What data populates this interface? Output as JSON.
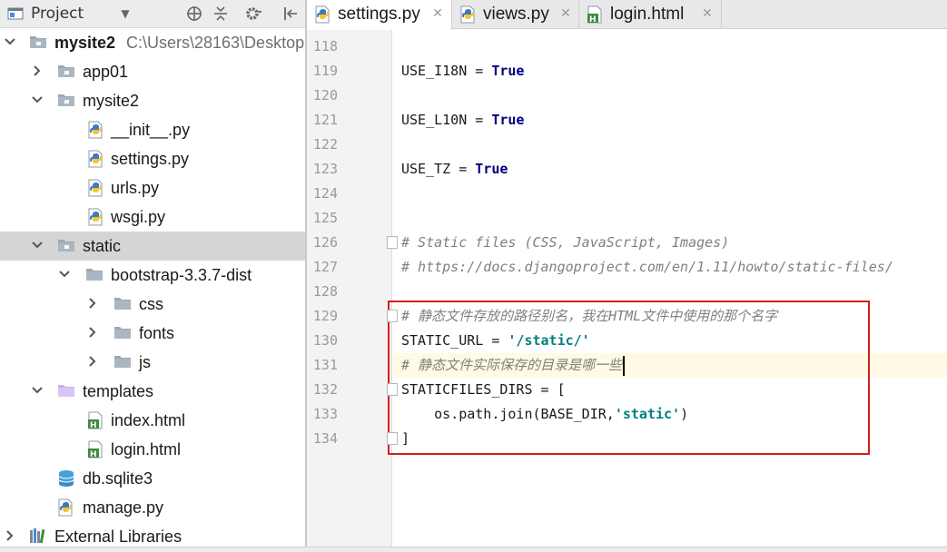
{
  "project_panel": {
    "title": "Project",
    "tree": [
      {
        "label": "mysite2",
        "path": "C:\\Users\\28163\\Desktop",
        "bold": true
      },
      {
        "label": "app01"
      },
      {
        "label": "mysite2"
      },
      {
        "label": "__init__.py"
      },
      {
        "label": "settings.py"
      },
      {
        "label": "urls.py"
      },
      {
        "label": "wsgi.py"
      },
      {
        "label": "static",
        "selected": true
      },
      {
        "label": "bootstrap-3.3.7-dist"
      },
      {
        "label": "css"
      },
      {
        "label": "fonts"
      },
      {
        "label": "js"
      },
      {
        "label": "templates"
      },
      {
        "label": "index.html"
      },
      {
        "label": "login.html"
      },
      {
        "label": "db.sqlite3"
      },
      {
        "label": "manage.py"
      },
      {
        "label": "External Libraries"
      }
    ]
  },
  "tabs": [
    {
      "label": "settings.py",
      "active": true,
      "icon": "python-file-icon"
    },
    {
      "label": "views.py",
      "active": false,
      "icon": "python-file-icon"
    },
    {
      "label": "login.html",
      "active": false,
      "icon": "html-file-icon"
    }
  ],
  "editor": {
    "line_numbers": [
      "118",
      "119",
      "120",
      "121",
      "122",
      "123",
      "124",
      "125",
      "126",
      "127",
      "128",
      "129",
      "130",
      "131",
      "132",
      "133",
      "134"
    ],
    "lines": [
      {
        "text": ""
      },
      {
        "parts": [
          {
            "t": "USE_I18N = "
          },
          {
            "t": "True",
            "c": "kw"
          }
        ]
      },
      {
        "text": ""
      },
      {
        "parts": [
          {
            "t": "USE_L10N = "
          },
          {
            "t": "True",
            "c": "kw"
          }
        ]
      },
      {
        "text": ""
      },
      {
        "parts": [
          {
            "t": "USE_TZ = "
          },
          {
            "t": "True",
            "c": "kw"
          }
        ]
      },
      {
        "text": ""
      },
      {
        "text": ""
      },
      {
        "text": "# Static files (CSS, JavaScript, Images)",
        "comment": true
      },
      {
        "text": "# https://docs.djangoproject.com/en/1.11/howto/static-files/",
        "comment": true
      },
      {
        "text": ""
      },
      {
        "text": "# 静态文件存放的路径别名，我在HTML文件中使用的那个名字",
        "comment": true
      },
      {
        "parts": [
          {
            "t": "STATIC_URL = "
          },
          {
            "t": "'/static/'",
            "c": "str"
          }
        ]
      },
      {
        "text": "# 静态文件实际保存的目录是哪一些",
        "comment": true,
        "caret": true
      },
      {
        "text": "STATICFILES_DIRS = ["
      },
      {
        "parts": [
          {
            "t": "    os.path.join(BASE_DIR,"
          },
          {
            "t": "'static'",
            "c": "str"
          },
          {
            "t": ")"
          }
        ]
      },
      {
        "text": "]"
      }
    ],
    "current_line_index": 13
  },
  "colors": {
    "keyword": "#000080",
    "string": "#008080",
    "comment": "#808080",
    "highlight_box": "#d31f1f",
    "current_line": "#fffae3"
  }
}
